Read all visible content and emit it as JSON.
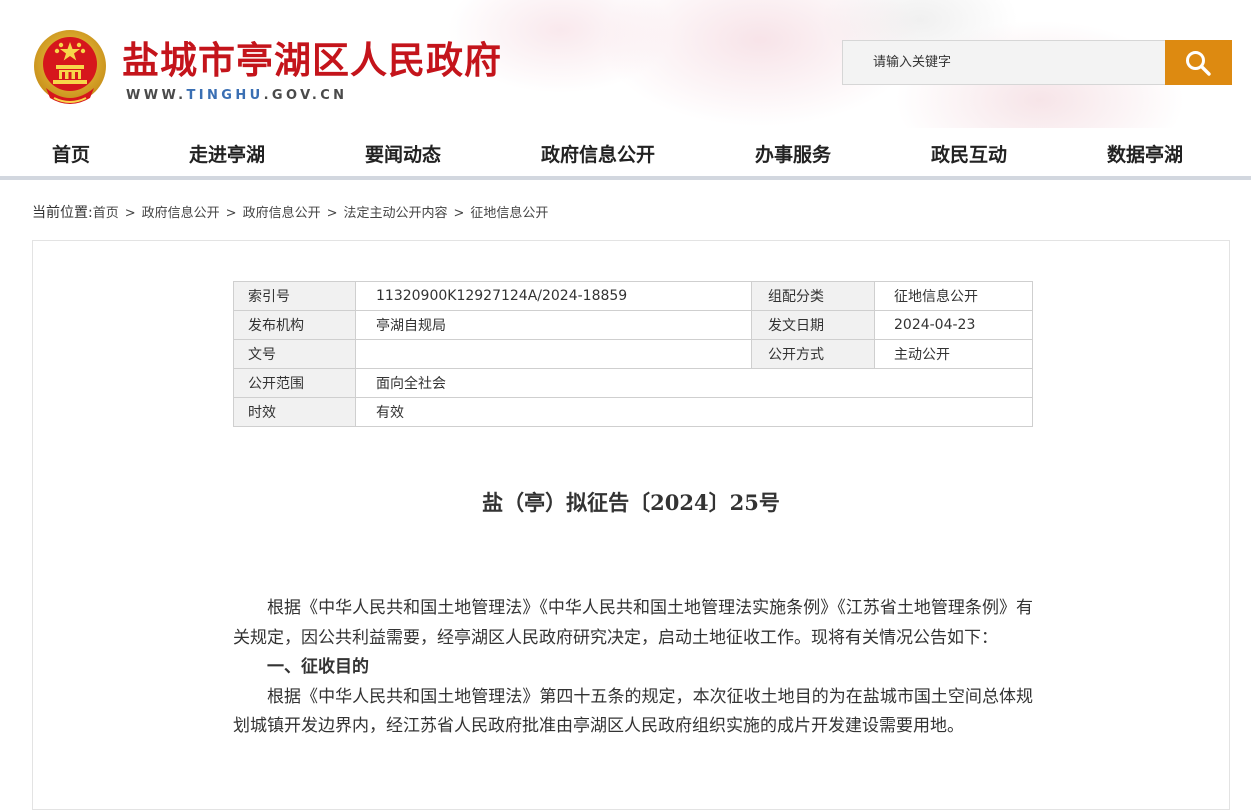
{
  "header": {
    "site_title": "盐城市亭湖区人民政府",
    "site_url_parts": [
      "WWW.",
      "TINGHU",
      ".GOV.CN"
    ]
  },
  "search": {
    "placeholder": "请输入关键字",
    "icon": "search-icon"
  },
  "nav": {
    "items": [
      "首页",
      "走进亭湖",
      "要闻动态",
      "政府信息公开",
      "办事服务",
      "政民互动",
      "数据亭湖"
    ]
  },
  "breadcrumb": {
    "lead": "当前位置:",
    "items": [
      "首页",
      "政府信息公开",
      "政府信息公开",
      "法定主动公开内容",
      "征地信息公开"
    ],
    "separator": ">"
  },
  "meta": {
    "rows": [
      {
        "k1": "索引号",
        "v1": "11320900K12927124A/2024-18859",
        "k2": "组配分类",
        "v2": "征地信息公开"
      },
      {
        "k1": "发布机构",
        "v1": "亭湖自规局",
        "k2": "发文日期",
        "v2": "2024-04-23"
      },
      {
        "k1": "文号",
        "v1": "",
        "k2": "公开方式",
        "v2": "主动公开"
      },
      {
        "k1": "公开范围",
        "v1": "面向全社会"
      },
      {
        "k1": "时效",
        "v1": "有效"
      }
    ]
  },
  "doc": {
    "title": "盐（亭）拟征告〔2024〕25号",
    "paragraphs": [
      "根据《中华人民共和国土地管理法》《中华人民共和国土地管理法实施条例》《江苏省土地管理条例》有关规定，因公共利益需要，经亭湖区人民政府研究决定，启动土地征收工作。现将有关情况公告如下：",
      "一、征收目的",
      "根据《中华人民共和国土地管理法》第四十五条的规定，本次征收土地目的为在盐城市国土空间总体规划城镇开发边界内，经江苏省人民政府批准由亭湖区人民政府组织实施的成片开发建设需要用地。"
    ]
  },
  "colors": {
    "brand_red": "#c4141b",
    "accent_orange": "#dd8a11",
    "url_blue": "#3a6fb3"
  }
}
